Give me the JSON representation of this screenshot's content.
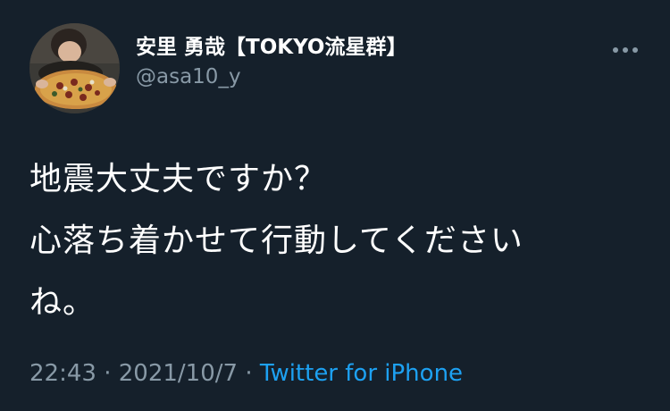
{
  "tweet": {
    "author": {
      "display_name": "安里 勇哉【TOKYO流星群】",
      "handle": "@asa10_y"
    },
    "text_lines": [
      "地震大丈夫ですか？",
      "心落ち着かせて行動してください",
      "ね。"
    ],
    "meta": {
      "time": "22:43",
      "separator": "·",
      "date": "2021/10/7",
      "source": "Twitter for iPhone"
    }
  },
  "icons": {
    "more": "more-horizontal-icon"
  },
  "colors": {
    "background": "#15202b",
    "text_primary": "#ffffff",
    "text_secondary": "#8899a6",
    "accent": "#1da1f2"
  }
}
